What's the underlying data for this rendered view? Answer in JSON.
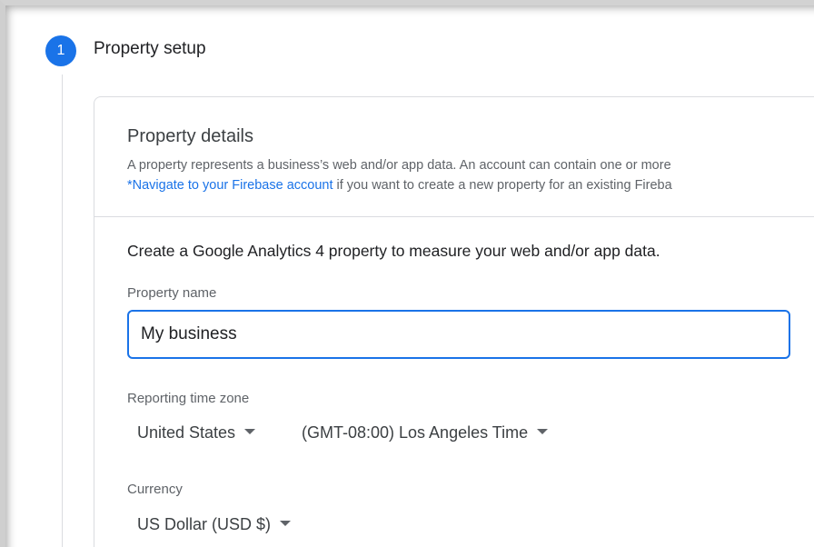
{
  "step": {
    "number": "1",
    "title": "Property setup"
  },
  "details": {
    "title": "Property details",
    "description": "A property represents a business’s web and/or app data. An account can contain one or more",
    "firebase_link": "*Navigate to your Firebase account",
    "firebase_rest": " if you want to create a new property for an existing Fireba"
  },
  "intro": "Create a Google Analytics 4 property to measure your web and/or app data.",
  "property_name": {
    "label": "Property name",
    "value": "My business"
  },
  "time_zone": {
    "label": "Reporting time zone",
    "country": "United States",
    "zone": "(GMT-08:00) Los Angeles Time"
  },
  "currency": {
    "label": "Currency",
    "value": "US Dollar (USD $)"
  },
  "colors": {
    "accent": "#1a73e8",
    "border": "#dadce0",
    "text_secondary": "#5f6368"
  }
}
